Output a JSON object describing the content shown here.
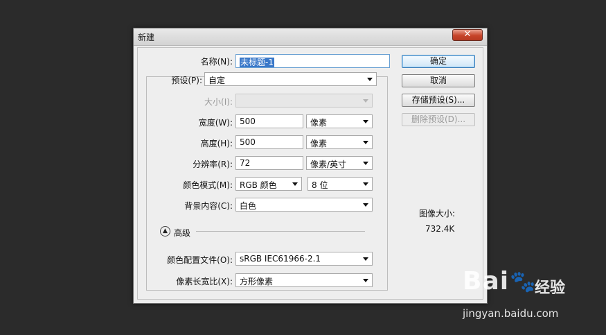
{
  "dialog": {
    "title": "新建",
    "close_label": "✕"
  },
  "form": {
    "name": {
      "label": "名称(N):",
      "value": "未标题-1"
    },
    "preset": {
      "label": "预设(P):",
      "value": "自定"
    },
    "size": {
      "label": "大小(I):",
      "value": ""
    },
    "width": {
      "label": "宽度(W):",
      "value": "500",
      "unit": "像素"
    },
    "height": {
      "label": "高度(H):",
      "value": "500",
      "unit": "像素"
    },
    "resolution": {
      "label": "分辨率(R):",
      "value": "72",
      "unit": "像素/英寸"
    },
    "color_mode": {
      "label": "颜色模式(M):",
      "value": "RGB 颜色",
      "bits": "8 位"
    },
    "background": {
      "label": "背景内容(C):",
      "value": "白色"
    },
    "advanced_label": "高级",
    "color_profile": {
      "label": "颜色配置文件(O):",
      "value": "sRGB IEC61966-2.1"
    },
    "pixel_aspect": {
      "label": "像素长宽比(X):",
      "value": "方形像素"
    }
  },
  "buttons": {
    "ok": "确定",
    "cancel": "取消",
    "save_preset": "存储预设(S)...",
    "delete_preset": "删除预设(D)..."
  },
  "image_size": {
    "label": "图像大小:",
    "value": "732.4K"
  },
  "watermark": {
    "brand": "Bai",
    "brand_suffix": "du",
    "cn": "经验",
    "url": "jingyan.baidu.com"
  }
}
